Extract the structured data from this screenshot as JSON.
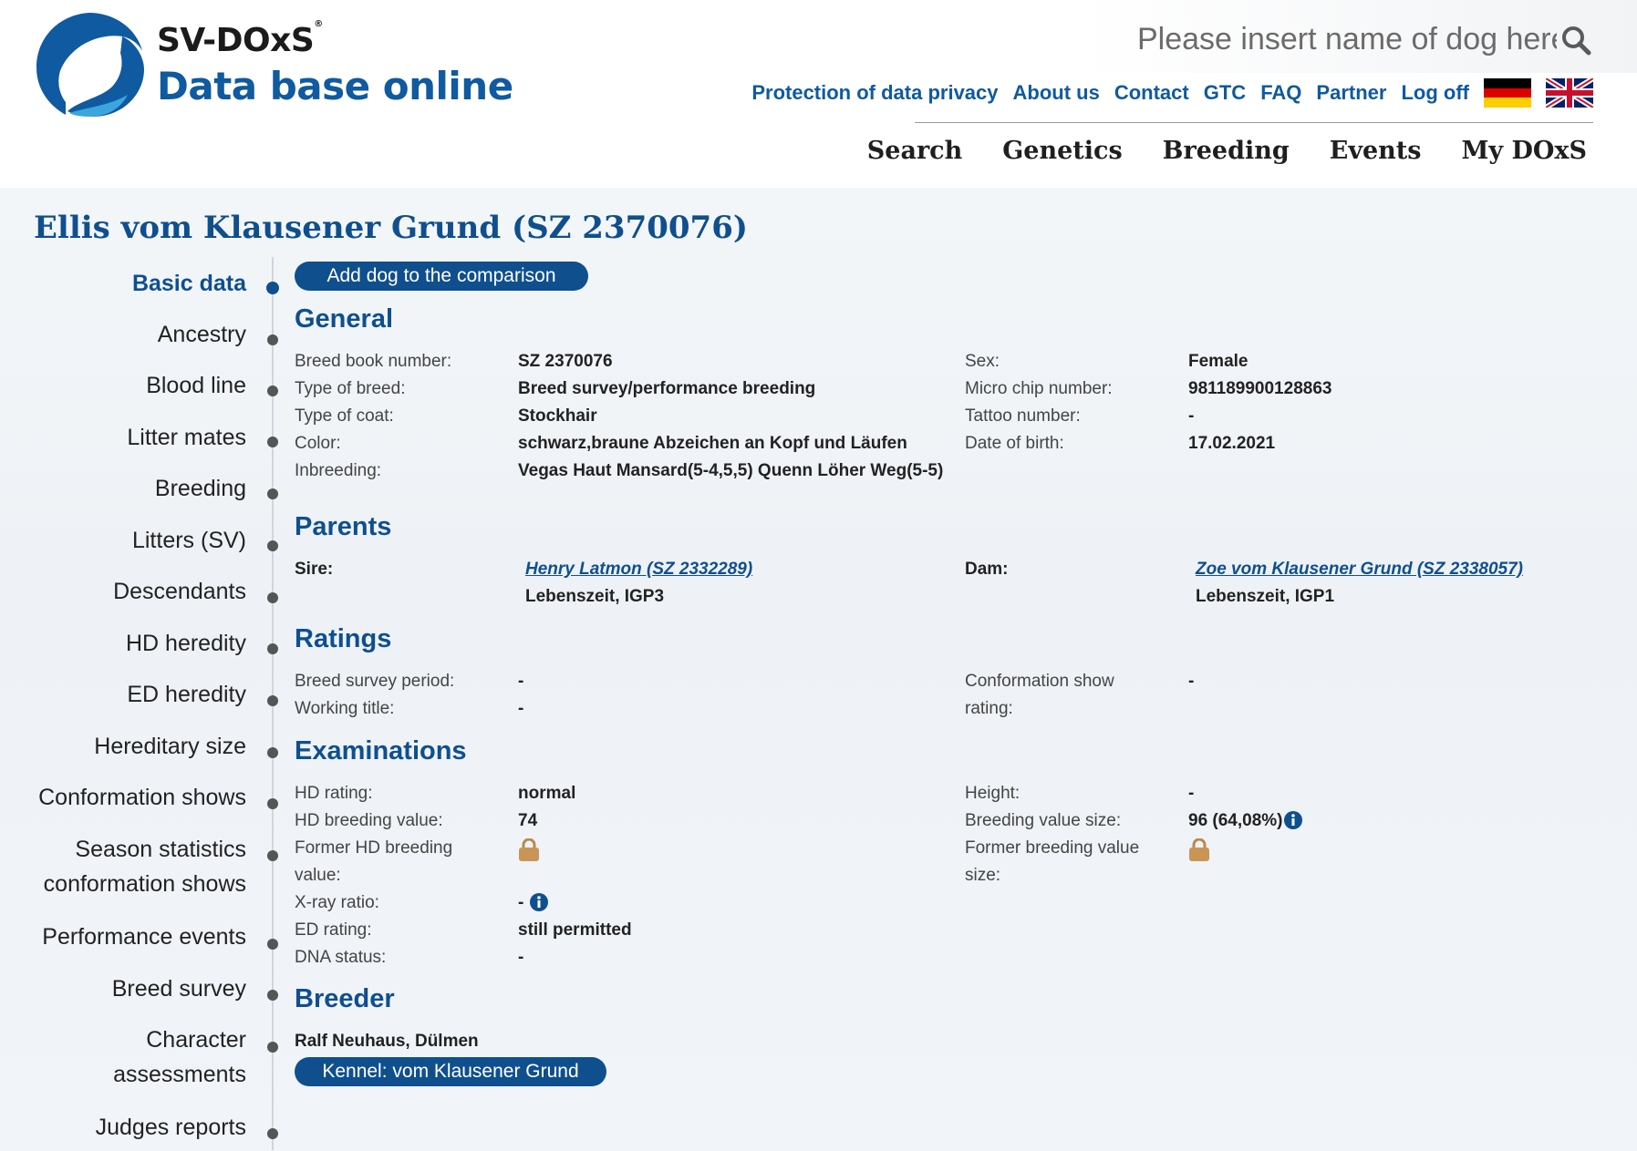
{
  "brand": {
    "title": "SV-DOxS",
    "registered": "®",
    "subtitle": "Data base online",
    "accent_color": "#0f5aa0"
  },
  "search": {
    "placeholder": "Please insert name of dog here"
  },
  "toplinks": [
    "Protection of data privacy",
    "About us",
    "Contact",
    "GTC",
    "FAQ",
    "Partner",
    "Log off"
  ],
  "mainnav": [
    "Search",
    "Genetics",
    "Breeding",
    "Events",
    "My DOxS"
  ],
  "page_title": "Ellis vom Klausener Grund (SZ 2370076)",
  "compare_button": "Add dog to the comparison",
  "sidenav": [
    "Basic data",
    "Ancestry",
    "Blood line",
    "Litter mates",
    "Breeding",
    "Litters (SV)",
    "Descendants",
    "HD heredity",
    "ED heredity",
    "Hereditary size",
    "Conformation shows",
    "Season statistics",
    "conformation shows",
    "Performance events",
    "Breed survey",
    "Character",
    "assessments",
    "Judges reports"
  ],
  "general": {
    "heading": "General",
    "breed_book_label": "Breed book number:",
    "breed_book": "SZ 2370076",
    "type_breed_label": "Type of breed:",
    "type_breed": "Breed survey/performance breeding",
    "type_coat_label": "Type of coat:",
    "type_coat": "Stockhair",
    "color_label": "Color:",
    "color": "schwarz,braune Abzeichen an Kopf und Läufen",
    "inbreeding_label": "Inbreeding:",
    "inbreeding": "Vegas Haut Mansard(5-4,5,5) Quenn Löher Weg(5-5)",
    "sex_label": "Sex:",
    "sex": "Female",
    "chip_label": "Micro chip number:",
    "chip": "981189900128863",
    "tattoo_label": "Tattoo number:",
    "tattoo": "-",
    "dob_label": "Date of birth:",
    "dob": "17.02.2021"
  },
  "parents": {
    "heading": "Parents",
    "sire_label": "Sire:",
    "sire_name": "Henry Latmon (SZ 2332289)",
    "sire_info": "Lebenszeit, IGP3",
    "dam_label": "Dam:",
    "dam_name": "Zoe vom Klausener Grund (SZ 2338057)",
    "dam_info": "Lebenszeit, IGP1"
  },
  "ratings": {
    "heading": "Ratings",
    "survey_period_label": "Breed survey period:",
    "survey_period": "-",
    "working_title_label": "Working title:",
    "working_title": "-",
    "conf_label_1": "Conformation show",
    "conf_label_2": "rating:",
    "conf": "-"
  },
  "exams": {
    "heading": "Examinations",
    "hd_rating_label": "HD rating:",
    "hd_rating": "normal",
    "hd_bv_label": "HD breeding value:",
    "hd_bv": "74",
    "former_hd_label_1": "Former HD breeding",
    "former_hd_label_2": "value:",
    "xray_label": "X-ray ratio:",
    "xray": "-",
    "ed_label": "ED rating:",
    "ed": "still permitted",
    "dna_label": "DNA status:",
    "dna": "-",
    "height_label": "Height:",
    "height": "-",
    "bv_size_label": "Breeding value size:",
    "bv_size": "96 (64,08%)",
    "former_bv_label_1": "Former breeding value",
    "former_bv_label_2": "size:"
  },
  "breeder": {
    "heading": "Breeder",
    "name": "Ralf Neuhaus, Dülmen",
    "kennel_button": "Kennel: vom Klausener Grund"
  },
  "icons": {
    "search": "search-icon",
    "lock": "lock-icon",
    "info": "info-icon",
    "flag_de": "flag-germany-icon",
    "flag_uk": "flag-uk-icon"
  }
}
